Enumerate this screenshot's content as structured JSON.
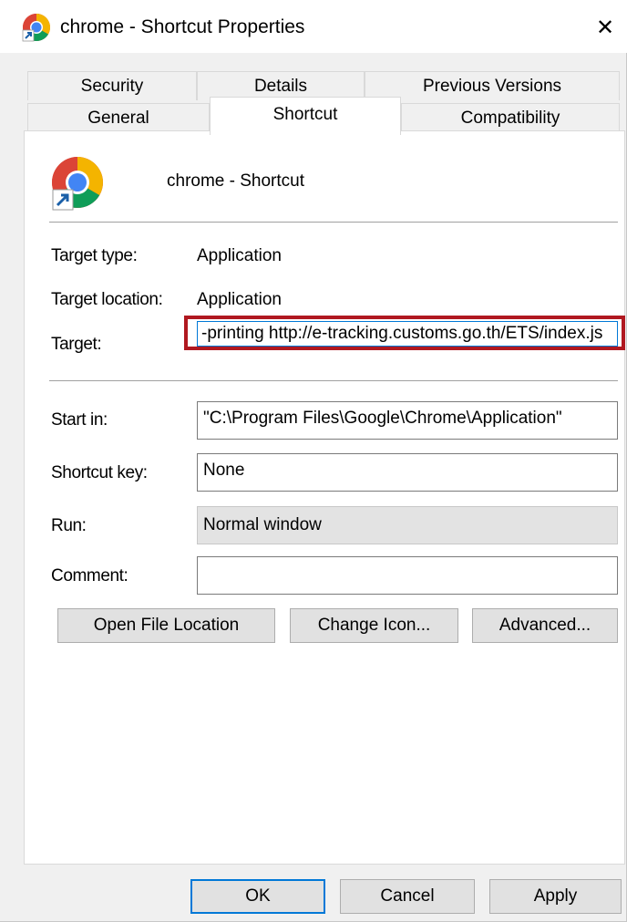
{
  "window": {
    "title": "chrome - Shortcut Properties",
    "icon": "chrome-icon",
    "close_glyph": "✕"
  },
  "tabs": {
    "row1": [
      {
        "label": "Security"
      },
      {
        "label": "Details"
      },
      {
        "label": "Previous Versions"
      }
    ],
    "row2": [
      {
        "label": "General"
      },
      {
        "label": "Shortcut",
        "active": true
      },
      {
        "label": "Compatibility"
      }
    ]
  },
  "shortcut": {
    "name": "chrome - Shortcut",
    "target_type_label": "Target type:",
    "target_type_value": "Application",
    "target_location_label": "Target location:",
    "target_location_value": "Application",
    "target_label": "Target:",
    "target_value": "-printing http://e-tracking.customs.go.th/ETS/index.js",
    "start_in_label": "Start in:",
    "start_in_value": "\"C:\\Program Files\\Google\\Chrome\\Application\"",
    "shortcut_key_label": "Shortcut key:",
    "shortcut_key_value": "None",
    "run_label": "Run:",
    "run_value": "Normal window",
    "comment_label": "Comment:",
    "comment_value": ""
  },
  "actions": {
    "open_file_location": "Open File Location",
    "change_icon": "Change Icon...",
    "advanced": "Advanced..."
  },
  "footer": {
    "ok": "OK",
    "cancel": "Cancel",
    "apply": "Apply"
  },
  "colors": {
    "highlight": "#b01820",
    "focus": "#0078d7",
    "dialog_bg": "#f0f0f0"
  }
}
